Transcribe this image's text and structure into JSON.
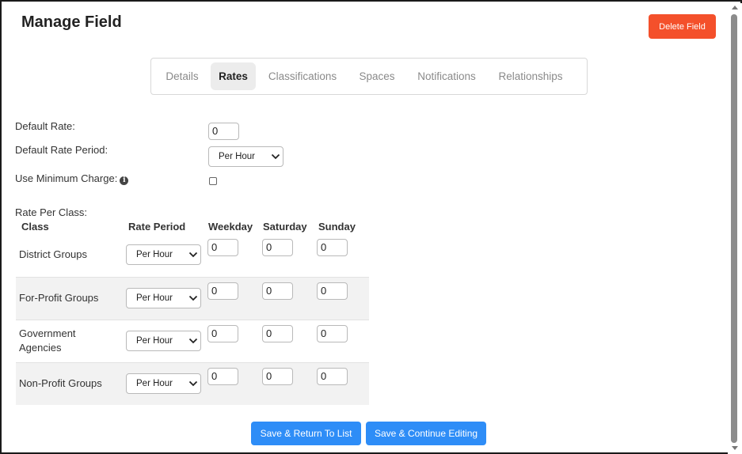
{
  "header": {
    "title": "Manage Field",
    "delete_label": "Delete Field"
  },
  "tabs": [
    {
      "label": "Details",
      "active": false
    },
    {
      "label": "Rates",
      "active": true
    },
    {
      "label": "Classifications",
      "active": false
    },
    {
      "label": "Spaces",
      "active": false
    },
    {
      "label": "Notifications",
      "active": false
    },
    {
      "label": "Relationships",
      "active": false
    }
  ],
  "form": {
    "default_rate_label": "Default Rate:",
    "default_rate_value": "0",
    "default_rate_period_label": "Default Rate Period:",
    "default_rate_period_value": "Per Hour",
    "use_min_charge_label": "Use Minimum Charge:",
    "use_min_charge_checked": false,
    "rate_per_class_label": "Rate Per Class:"
  },
  "table": {
    "headers": {
      "class": "Class",
      "rate_period": "Rate Period",
      "weekday": "Weekday",
      "saturday": "Saturday",
      "sunday": "Sunday"
    },
    "rows": [
      {
        "class": "District Groups",
        "rate_period": "Per Hour",
        "weekday": "0",
        "saturday": "0",
        "sunday": "0"
      },
      {
        "class": "For-Profit Groups",
        "rate_period": "Per Hour",
        "weekday": "0",
        "saturday": "0",
        "sunday": "0"
      },
      {
        "class": "Government Agencies",
        "rate_period": "Per Hour",
        "weekday": "0",
        "saturday": "0",
        "sunday": "0"
      },
      {
        "class": "Non-Profit Groups",
        "rate_period": "Per Hour",
        "weekday": "0",
        "saturday": "0",
        "sunday": "0"
      }
    ]
  },
  "actions": {
    "save_return_label": "Save & Return To List",
    "save_continue_label": "Save & Continue Editing"
  },
  "colors": {
    "danger": "#f4502b",
    "primary": "#2e8df7",
    "active_tab_bg": "#ececec",
    "alt_row_bg": "#f2f2f2"
  },
  "icons": {
    "info": "info-circle-icon",
    "select_chevron": "chevron-down-icon"
  }
}
